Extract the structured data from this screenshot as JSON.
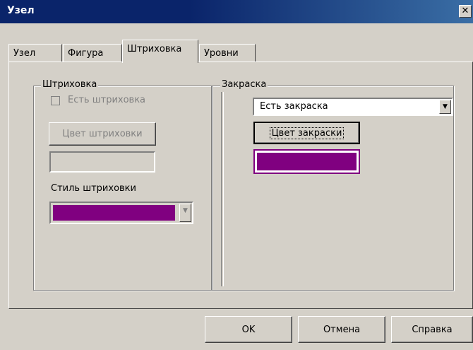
{
  "window": {
    "title": "Узел",
    "close_glyph": "✕"
  },
  "tabs": [
    {
      "label": "Узел"
    },
    {
      "label": "Фигура"
    },
    {
      "label": "Штриховка"
    },
    {
      "label": "Уровни"
    }
  ],
  "hatching": {
    "legend": "Штриховка",
    "has_hatching_label": "Есть штриховка",
    "has_hatching_checked": false,
    "color_button": "Цвет штриховки",
    "style_label": "Стиль штриховки",
    "style_color": "#800080"
  },
  "fill": {
    "legend": "Закраска",
    "select_value": "Есть закраска",
    "color_button": "Цвет закраски",
    "color_swatch": "#800080"
  },
  "footer": {
    "ok": "OK",
    "cancel": "Отмена",
    "help": "Справка"
  },
  "icons": {
    "dropdown": "▼"
  }
}
